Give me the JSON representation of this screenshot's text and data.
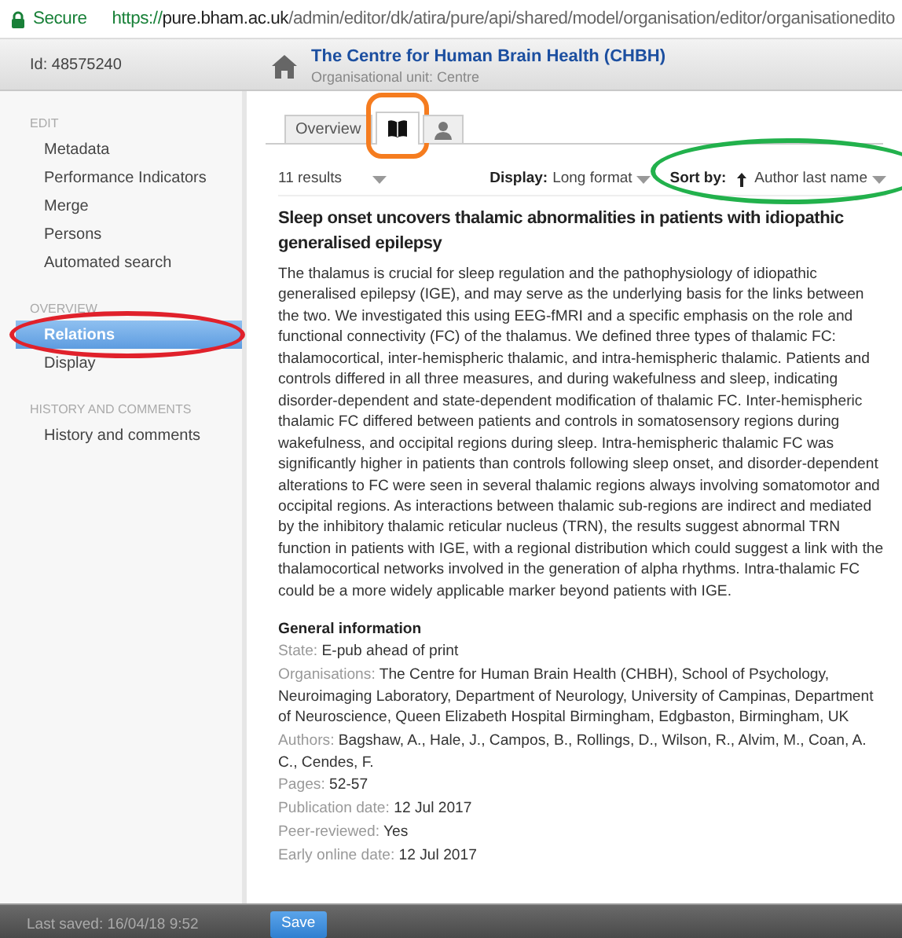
{
  "address_bar": {
    "secure_label": "Secure",
    "url_scheme": "https://",
    "url_host": "pure.bham.ac.uk",
    "url_path": "/admin/editor/dk/atira/pure/api/shared/model/organisation/editor/organisationedito"
  },
  "header": {
    "id_label": "Id: 48575240",
    "title": "The Centre for Human Brain Health (CHBH)",
    "subtitle": "Organisational unit: Centre"
  },
  "sidebar": {
    "sections": [
      {
        "heading": "EDIT",
        "items": [
          {
            "label": "Metadata",
            "selected": false
          },
          {
            "label": "Performance Indicators",
            "selected": false
          },
          {
            "label": "Merge",
            "selected": false
          },
          {
            "label": "Persons",
            "selected": false
          },
          {
            "label": "Automated search",
            "selected": false
          }
        ]
      },
      {
        "heading": "OVERVIEW",
        "items": [
          {
            "label": "Relations",
            "selected": true,
            "annotation": {
              "kind": "ellipse",
              "color": "#e0212b"
            }
          },
          {
            "label": "Display",
            "selected": false
          }
        ]
      },
      {
        "heading": "HISTORY AND COMMENTS",
        "items": [
          {
            "label": "History and comments",
            "selected": false
          }
        ]
      }
    ]
  },
  "tabs": [
    {
      "kind": "text",
      "label": "Overview",
      "selected": false
    },
    {
      "kind": "book",
      "selected": true,
      "annotation": {
        "kind": "box",
        "color": "#f57c1f"
      }
    },
    {
      "kind": "person",
      "selected": false
    }
  ],
  "toolbar": {
    "results": "11 results",
    "display_label": "Display:",
    "display_value": "Long format",
    "sort_label": "Sort by:",
    "sort_value": "Author last name",
    "sort_annotation": {
      "kind": "ellipse",
      "color": "#22b14c"
    }
  },
  "publication": {
    "title": "Sleep onset uncovers thalamic abnormalities in patients with idiopathic generalised epilepsy",
    "abstract": "The thalamus is crucial for sleep regulation and the pathophysiology of idiopathic generalised epilepsy (IGE), and may serve as the underlying basis for the links between the two. We investigated this using EEG-fMRI and a specific emphasis on the role and functional connectivity (FC) of the thalamus. We defined three types of thalamic FC: thalamocortical, inter-hemispheric thalamic, and intra-hemispheric thalamic. Patients and controls differed in all three measures, and during wakefulness and sleep, indicating disorder-dependent and state-dependent modification of thalamic FC. Inter-hemispheric thalamic FC differed between patients and controls in somatosensory regions during wakefulness, and occipital regions during sleep. Intra-hemispheric thalamic FC was significantly higher in patients than controls following sleep onset, and disorder-dependent alterations to FC were seen in several thalamic regions always involving somatomotor and occipital regions. As interactions between thalamic sub-regions are indirect and mediated by the inhibitory thalamic reticular nucleus (TRN), the results suggest abnormal TRN function in patients with IGE, with a regional distribution which could suggest a link with the thalamocortical networks involved in the generation of alpha rhythms. Intra-thalamic FC could be a more widely applicable marker beyond patients with IGE.",
    "info_heading": "General information",
    "fields": [
      {
        "label": "State:",
        "value": "E-pub ahead of print"
      },
      {
        "label": "Organisations:",
        "value": "The Centre for Human Brain Health (CHBH), School of Psychology, Neuroimaging Laboratory, Department of Neurology, University of Campinas, Department of Neuroscience, Queen Elizabeth Hospital Birmingham, Edgbaston, Birmingham, UK"
      },
      {
        "label": "Authors:",
        "value": "Bagshaw, A., Hale, J., Campos, B., Rollings, D., Wilson, R., Alvim, M., Coan, A. C., Cendes, F."
      },
      {
        "label": "Pages:",
        "value": "52-57"
      },
      {
        "label": "Publication date:",
        "value": "12 Jul 2017"
      },
      {
        "label": "Peer-reviewed:",
        "value": "Yes"
      },
      {
        "label": "Early online date:",
        "value": "12 Jul 2017"
      }
    ]
  },
  "footer": {
    "last_saved": "Last saved: 16/04/18 9:52",
    "save_button": "Save"
  }
}
